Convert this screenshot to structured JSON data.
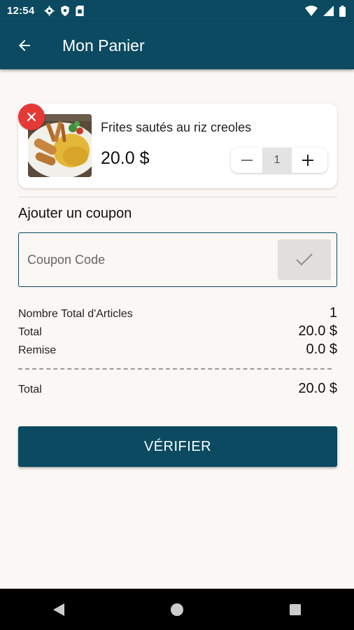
{
  "status_bar": {
    "time": "12:54",
    "icons": [
      "settings-icon",
      "shield-icon",
      "sim-card-icon"
    ],
    "right_icons": [
      "wifi-icon",
      "signal-icon",
      "battery-icon"
    ]
  },
  "app_bar": {
    "back_icon": "arrow-back-icon",
    "title": "Mon Panier"
  },
  "cart": {
    "items": [
      {
        "name": "Frites sautés au riz creoles",
        "price": "20.0 $",
        "quantity": "1",
        "remove_icon": "close-icon"
      }
    ]
  },
  "coupon": {
    "heading": "Ajouter un coupon",
    "placeholder": "Coupon Code",
    "value": "",
    "apply_icon": "check-icon"
  },
  "summary": {
    "total_items_label": "Nombre Total d'Articles",
    "total_items_value": "1",
    "total_label": "Total",
    "total_value": "20.0 $",
    "discount_label": "Remise",
    "discount_value": "0.0 $",
    "grand_total_label": "Total",
    "grand_total_value": "20.0 $"
  },
  "actions": {
    "verify_label": "VÉRIFIER"
  },
  "colors": {
    "primary": "#0b4a61",
    "remove": "#e53935",
    "background": "#fbf7f4"
  },
  "nav_bar": {
    "icons": [
      "back-triangle-icon",
      "home-circle-icon",
      "recents-square-icon"
    ]
  }
}
